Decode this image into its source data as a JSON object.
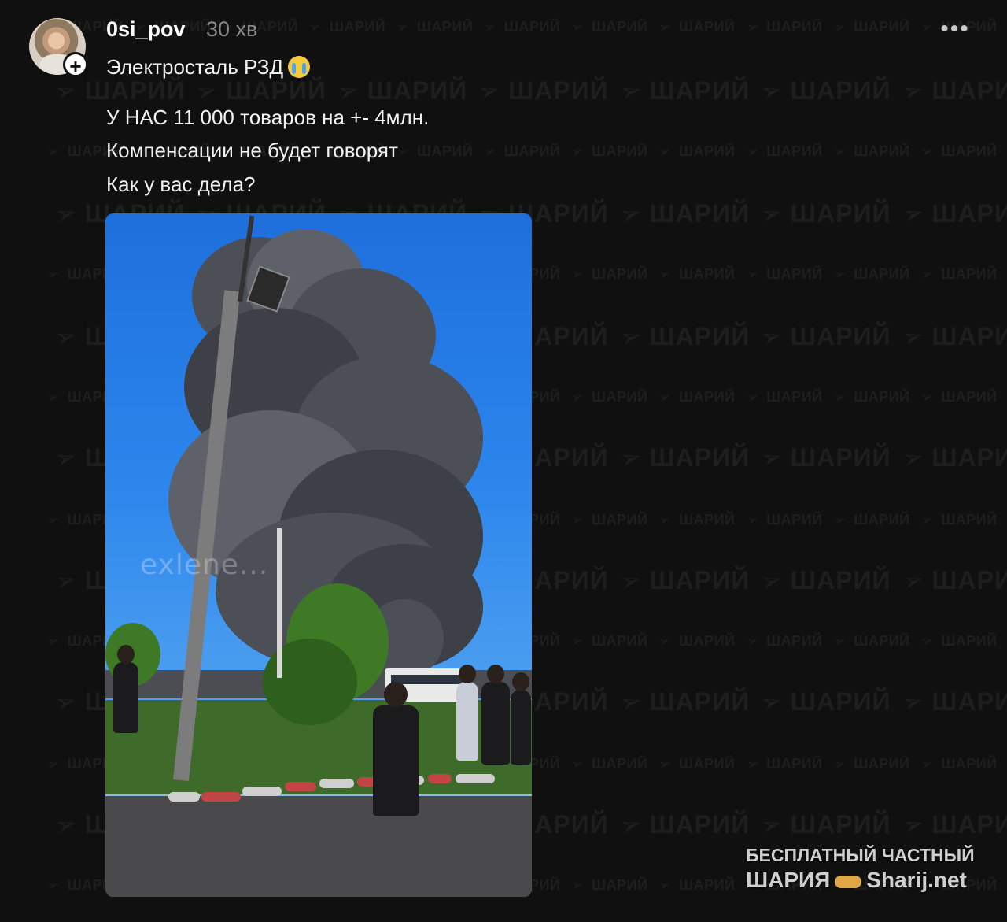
{
  "post": {
    "username": "0si_pov",
    "timestamp": "30 хв",
    "more_icon": "more-horizontal-icon",
    "more_glyph": "•••",
    "follow_glyph": "+",
    "lines": [
      "Электросталь РЗД",
      "У НАС 11 000 товаров на +- 4млн.",
      "Компенсации не будет говорят",
      "Как у вас дела?"
    ],
    "emoji": "crying-face-emoji"
  },
  "media": {
    "overlay_watermark": "exlene..."
  },
  "watermark": {
    "text": "ШАРИЙ",
    "icon": "telegram-plane-icon",
    "plane_glyph": "➢"
  },
  "branding": {
    "line1": "БЕСПЛАТНЫЙ ЧАСТНЫЙ",
    "line2_left": "ШАРИЯ",
    "line2_right": "Sharij.net"
  },
  "colors": {
    "background": "#101010",
    "username": "#ffffff",
    "timestamp": "#8a8a8a",
    "text": "#f2f2f2"
  }
}
